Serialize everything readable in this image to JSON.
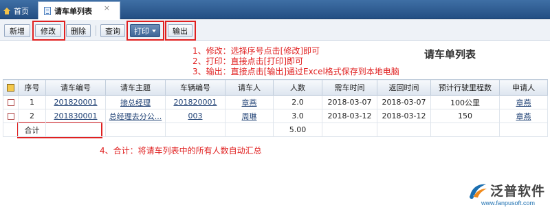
{
  "tabs": {
    "home_label": "首页",
    "active_label": "请车单列表",
    "close_glyph": "×"
  },
  "toolbar": {
    "buttons": [
      "新增",
      "修改",
      "删除",
      "查询",
      "打印",
      "输出"
    ]
  },
  "annotations": {
    "line1": "1、修改：选择序号点击[修改]即可",
    "line2": "2、打印：直接点击[打印]即可",
    "line3": "3、输出：直接点击[输出]通过Excel格式保存到本地电脑",
    "line4": "4、合计：将请车列表中的所有人数自动汇总",
    "color": "#e02020"
  },
  "page_title": "请车单列表",
  "table": {
    "headers": [
      "序号",
      "请车编号",
      "请车主题",
      "车辆编号",
      "请车人",
      "人数",
      "需车时间",
      "返回时间",
      "预计行驶里程数",
      "申请人"
    ],
    "rows": [
      {
        "seq": "1",
        "no": "201820001",
        "subject": "接总经理",
        "vehicle": "201820001",
        "requester": "章燕",
        "count": "2.0",
        "need_time": "2018-03-07",
        "return_time": "2018-03-07",
        "mileage": "100公里",
        "applicant": "章燕"
      },
      {
        "seq": "2",
        "no": "201830001",
        "subject": "总经理去分公...",
        "vehicle": "003",
        "requester": "周琳",
        "count": "3.0",
        "need_time": "2018-03-12",
        "return_time": "2018-03-12",
        "mileage": "150",
        "applicant": "章燕"
      }
    ],
    "total_label": "合计",
    "total_count": "5.00"
  },
  "logo": {
    "text": "泛普软件",
    "url": "www.fanpusoft.com"
  }
}
